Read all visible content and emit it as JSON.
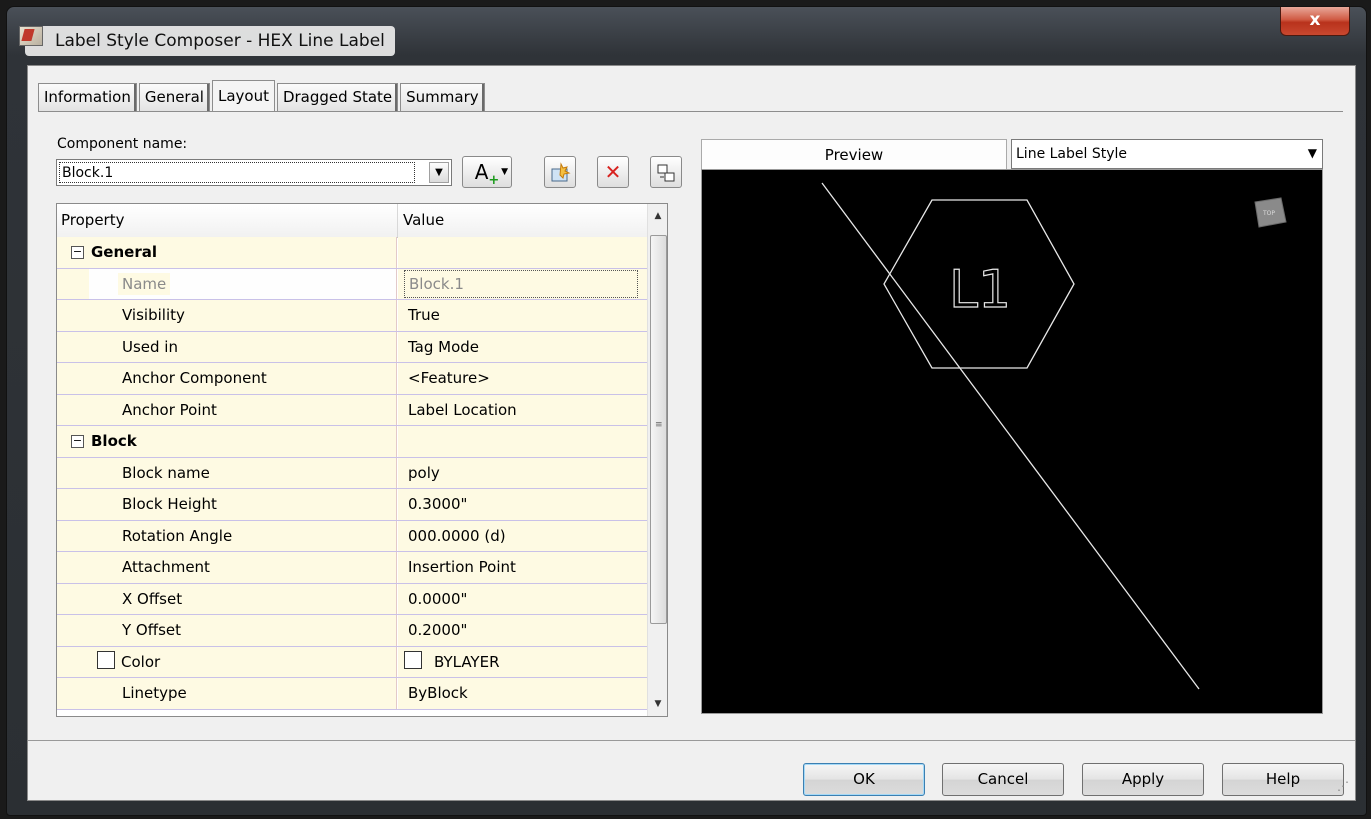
{
  "window": {
    "title": "Label Style Composer - HEX Line Label",
    "close_label": "x"
  },
  "tabs": [
    {
      "label": "Information",
      "active": false
    },
    {
      "label": "General",
      "active": false
    },
    {
      "label": "Layout",
      "active": true
    },
    {
      "label": "Dragged State",
      "active": false
    },
    {
      "label": "Summary",
      "active": false
    }
  ],
  "component": {
    "label": "Component name:",
    "value": "Block.1"
  },
  "toolbar": {
    "add_component_glyph": "A",
    "add_component_plus": "+",
    "delete_glyph": "✕"
  },
  "grid": {
    "col_property": "Property",
    "col_value": "Value",
    "rows": [
      {
        "type": "category",
        "property": "General",
        "value": ""
      },
      {
        "type": "item",
        "property": "Name",
        "value": "Block.1",
        "disabled": true
      },
      {
        "type": "item",
        "property": "Visibility",
        "value": "True"
      },
      {
        "type": "item",
        "property": "Used in",
        "value": "Tag Mode"
      },
      {
        "type": "item",
        "property": "Anchor Component",
        "value": "<Feature>"
      },
      {
        "type": "item",
        "property": "Anchor Point",
        "value": "Label Location"
      },
      {
        "type": "category",
        "property": "Block",
        "value": ""
      },
      {
        "type": "item",
        "property": "Block name",
        "value": "poly"
      },
      {
        "type": "item",
        "property": "Block Height",
        "value": "0.3000\""
      },
      {
        "type": "item",
        "property": "Rotation Angle",
        "value": "000.0000 (d)"
      },
      {
        "type": "item",
        "property": "Attachment",
        "value": "Insertion Point"
      },
      {
        "type": "item",
        "property": "X Offset",
        "value": "0.0000\""
      },
      {
        "type": "item",
        "property": "Y Offset",
        "value": "0.2000\""
      },
      {
        "type": "checkitem",
        "property": "Color",
        "value": "BYLAYER"
      },
      {
        "type": "item",
        "property": "Linetype",
        "value": "ByBlock"
      }
    ]
  },
  "preview": {
    "tab_label": "Preview",
    "style_selected": "Line Label Style",
    "label_text": "L1",
    "viewcube_label": "TOP"
  },
  "buttons": {
    "ok": "OK",
    "cancel": "Cancel",
    "apply": "Apply",
    "help": "Help"
  }
}
